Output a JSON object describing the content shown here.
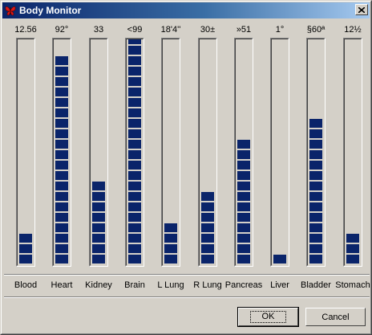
{
  "window": {
    "title": "Body Monitor"
  },
  "colors": {
    "segment": "#0a246a",
    "title_start": "#0a246a",
    "title_end": "#a6caf0",
    "face": "#d4d0c8"
  },
  "icons": {
    "app": "red-butterfly-icon",
    "close": "close-icon"
  },
  "gauge_scale": {
    "max_segments": 20
  },
  "gauges": [
    {
      "organ": "Blood",
      "value": "12.56",
      "level": 3
    },
    {
      "organ": "Heart",
      "value": "92°",
      "level": 20
    },
    {
      "organ": "Kidney",
      "value": "33",
      "level": 8
    },
    {
      "organ": "Brain",
      "value": "<99",
      "level": 22
    },
    {
      "organ": "L Lung",
      "value": "18'4''",
      "level": 4
    },
    {
      "organ": "R Lung",
      "value": "30±",
      "level": 7
    },
    {
      "organ": "Pancreas",
      "value": "»51",
      "level": 12
    },
    {
      "organ": "Liver",
      "value": "1°",
      "level": 1
    },
    {
      "organ": "Bladder",
      "value": "§60ª",
      "level": 14
    },
    {
      "organ": "Stomach",
      "value": "12½",
      "level": 3
    }
  ],
  "buttons": {
    "ok": "OK",
    "cancel": "Cancel"
  }
}
